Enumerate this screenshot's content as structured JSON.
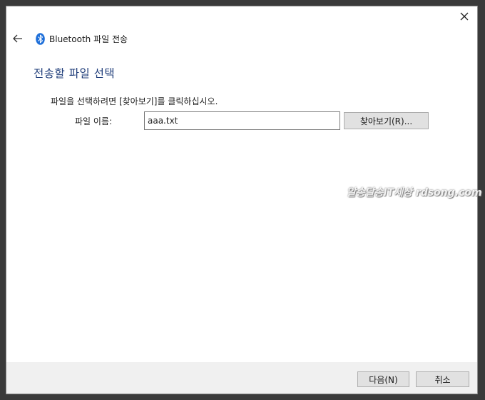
{
  "window": {
    "title": "Bluetooth 파일 전송",
    "close_icon": "close-icon",
    "back_icon": "back-arrow-icon",
    "app_icon": "bluetooth-icon"
  },
  "page": {
    "title": "전송할 파일 선택",
    "instruction": "파일을 선택하려면 [찾아보기]를 클릭하십시오.",
    "filename_label": "파일 이름:",
    "filename_value": "aaa.txt",
    "browse_label": "찾아보기(R)..."
  },
  "watermark": "알송달송IT세상 rdsong.com",
  "footer": {
    "next_label": "다음(N)",
    "cancel_label": "취소"
  },
  "colors": {
    "title_blue": "#1f3d7a",
    "bluetooth_blue": "#1e6fd9",
    "footer_bg": "#f0f0f0"
  }
}
